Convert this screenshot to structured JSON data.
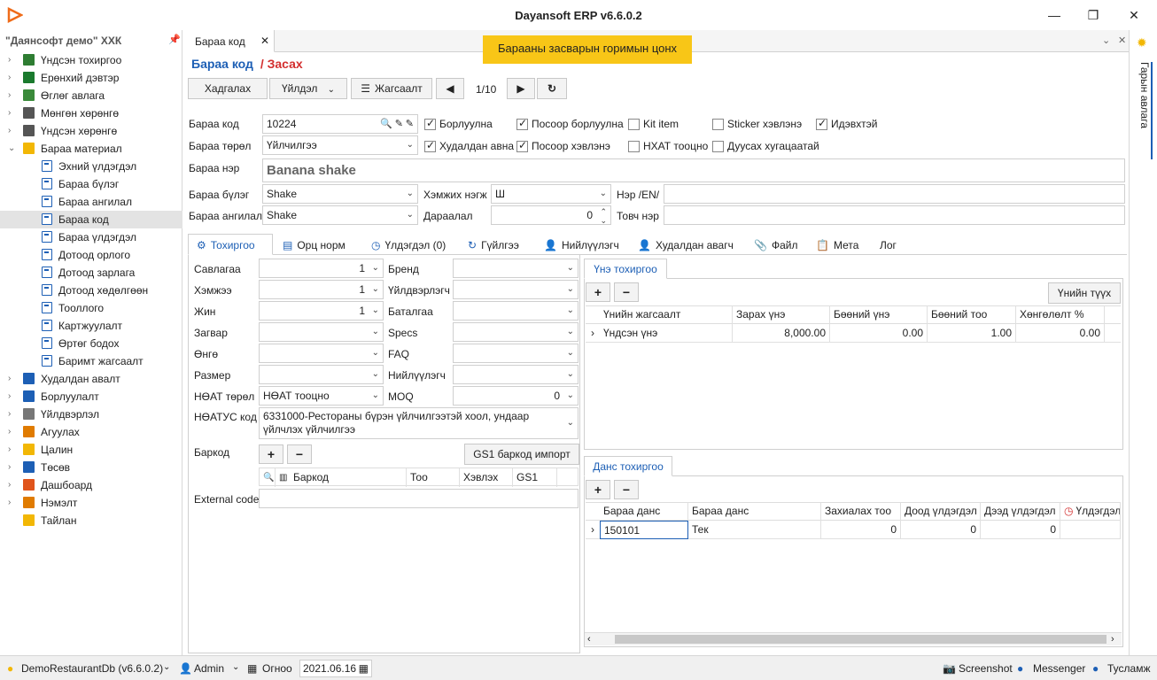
{
  "window": {
    "title": "Dayansoft ERP v6.6.0.2",
    "minimize": "—",
    "maximize": "❐",
    "close": "✕"
  },
  "sidebar": {
    "title": "\"Даянсофт демо\" ХХК",
    "items": [
      {
        "label": "Үндсэн тохиргоо",
        "level": 0,
        "expand": "›",
        "color": "#2e7d32"
      },
      {
        "label": "Ерөнхий дэвтэр",
        "level": 0,
        "expand": "›",
        "color": "#1b7a2e"
      },
      {
        "label": "Өглөг авлага",
        "level": 0,
        "expand": "›",
        "color": "#3a8a3a"
      },
      {
        "label": "Мөнгөн хөрөнгө",
        "level": 0,
        "expand": "›",
        "color": "#555555"
      },
      {
        "label": "Үндсэн хөрөнгө",
        "level": 0,
        "expand": "›",
        "color": "#555555"
      },
      {
        "label": "Бараа материал",
        "level": 0,
        "expand": "⌄",
        "color": "#f2b705"
      },
      {
        "label": "Эхний үлдэгдэл",
        "level": 1
      },
      {
        "label": "Бараа бүлэг",
        "level": 1
      },
      {
        "label": "Бараа ангилал",
        "level": 1
      },
      {
        "label": "Бараа код",
        "level": 1,
        "selected": true
      },
      {
        "label": "Бараа үлдэгдэл",
        "level": 1
      },
      {
        "label": "Дотоод орлого",
        "level": 1
      },
      {
        "label": "Дотоод зарлага",
        "level": 1
      },
      {
        "label": "Дотоод хөдөлгөөн",
        "level": 1
      },
      {
        "label": "Тооллого",
        "level": 1
      },
      {
        "label": "Картжуулалт",
        "level": 1
      },
      {
        "label": "Өртөг бодох",
        "level": 1
      },
      {
        "label": "Баримт жагсаалт",
        "level": 1
      },
      {
        "label": "Худалдан авалт",
        "level": 0,
        "expand": "›",
        "color": "#1d5fb5"
      },
      {
        "label": "Борлуулалт",
        "level": 0,
        "expand": "›",
        "color": "#1d5fb5"
      },
      {
        "label": "Үйлдвэрлэл",
        "level": 0,
        "expand": "›",
        "color": "#777777"
      },
      {
        "label": "Агуулах",
        "level": 0,
        "expand": "›",
        "color": "#e07b00"
      },
      {
        "label": "Цалин",
        "level": 0,
        "expand": "›",
        "color": "#f2b705"
      },
      {
        "label": "Төсөв",
        "level": 0,
        "expand": "›",
        "color": "#1d5fb5"
      },
      {
        "label": "Дашбоард",
        "level": 0,
        "expand": "›",
        "color": "#e0541b"
      },
      {
        "label": "Нэмэлт",
        "level": 0,
        "expand": "›",
        "color": "#e07b00"
      },
      {
        "label": "Тайлан",
        "level": 0,
        "expand": "",
        "color": "#f2b705"
      }
    ]
  },
  "doc_tab": {
    "label": "Бараа код",
    "close": "✕"
  },
  "tooltip": "Барааны засварын горимын цонх",
  "heading": {
    "title": "Бараа код",
    "mode": "/ Засах"
  },
  "toolbar": {
    "save": "Хадгалах",
    "action": "Үйлдэл",
    "list": "Жагсаалт",
    "page": "1/10"
  },
  "form": {
    "code_label": "Бараа код",
    "code_value": "10224",
    "type_label": "Бараа төрөл",
    "type_value": "Үйлчилгээ",
    "name_label": "Бараа нэр",
    "name_value": "Banana shake",
    "group_label": "Бараа бүлэг",
    "group_value": "Shake",
    "class_label": "Бараа ангилал",
    "class_value": "Shake",
    "unit_label": "Хэмжих нэгж",
    "unit_value": "Ш",
    "order_label": "Дараалал",
    "order_value": "0",
    "name_en_label": "Нэр /EN/",
    "short_label": "Товч нэр",
    "checks": [
      {
        "label": "Борлуулна",
        "on": true
      },
      {
        "label": "Посоор борлуулна",
        "on": true
      },
      {
        "label": "Kit item",
        "on": false
      },
      {
        "label": "Sticker хэвлэнэ",
        "on": false
      },
      {
        "label": "Идэвхтэй",
        "on": true
      },
      {
        "label": "Худалдан авна",
        "on": true
      },
      {
        "label": "Посоор хэвлэнэ",
        "on": true
      },
      {
        "label": "НХАТ тооцно",
        "on": false
      },
      {
        "label": "Дуусах хугацаатай",
        "on": false
      }
    ]
  },
  "detail_tabs": [
    "Тохиргоо",
    "Орц норм",
    "Үлдэгдэл (0)",
    "Гүйлгээ",
    "Нийлүүлэгч",
    "Худалдан авагч",
    "Файл",
    "Мета",
    "Лог"
  ],
  "settings": {
    "pack_label": "Савлагаа",
    "pack_value": "1",
    "size_label": "Хэмжээ",
    "size_value": "1",
    "weight_label": "Жин",
    "weight_value": "1",
    "model_label": "Загвар",
    "color_label": "Өнгө",
    "dim_label": "Размер",
    "vat_label": "НӨАТ төрөл",
    "vat_value": "НӨАТ тооцно",
    "vatcode_label": "НӨАТУС код",
    "vatcode_value": "6331000-Рестораны бүрэн үйлчилгээтэй хоол, ундаар үйлчлэх үйлчилгээ",
    "brand_label": "Бренд",
    "maker_label": "Үйлдвэрлэгч",
    "warranty_label": "Баталгаа",
    "specs_label": "Specs",
    "faq_label": "FAQ",
    "supplier_label": "Нийлүүлэгч",
    "moq_label": "MOQ",
    "moq_value": "0",
    "barcode_label": "Баркод",
    "gs1_button": "GS1 баркод импорт",
    "barcode_cols": [
      "Баркод",
      "Тоо",
      "Хэвлэх",
      "GS1"
    ],
    "external_label": "External code"
  },
  "price_panel": {
    "tab": "Үнэ тохиргоо",
    "history_button": "Үнийн түүх",
    "cols": [
      "Үнийн жагсаалт",
      "Зарах үнэ",
      "Бөөний үнэ",
      "Бөөний тоо",
      "Хөнгөлөлт %"
    ],
    "row": [
      "Үндсэн үнэ",
      "8,000.00",
      "0.00",
      "1.00",
      "0.00"
    ]
  },
  "account_panel": {
    "tab": "Данс тохиргоо",
    "cols": [
      "Бараа данс",
      "Бараа данс",
      "Захиалах тоо",
      "Доод үлдэгдэл",
      "Дээд үлдэгдэл",
      "Үлдэгдэл"
    ],
    "row": [
      "150101",
      "Тек",
      "0",
      "0",
      "0",
      ""
    ]
  },
  "rail": {
    "label": "Гарын авлага"
  },
  "status": {
    "db": "DemoRestaurantDb (v6.6.0.2)",
    "user": "Admin",
    "date_label": "Огноо",
    "date": "2021.06.16",
    "screenshot": "Screenshot",
    "messenger": "Messenger",
    "help": "Тусламж"
  }
}
